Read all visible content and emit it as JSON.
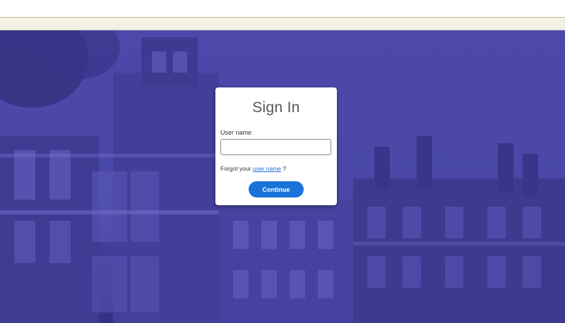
{
  "signin": {
    "title": "Sign In",
    "username_label": "User name",
    "username_value": "",
    "username_placeholder": "",
    "forgot_prefix": "Forgot your",
    "forgot_link": "user name",
    "forgot_suffix": "?",
    "continue_label": "Continue"
  },
  "colors": {
    "overlay": "#4d4aa8",
    "button": "#1a73d9",
    "link": "#1f6fe0",
    "strip": "#f3f0e6"
  }
}
